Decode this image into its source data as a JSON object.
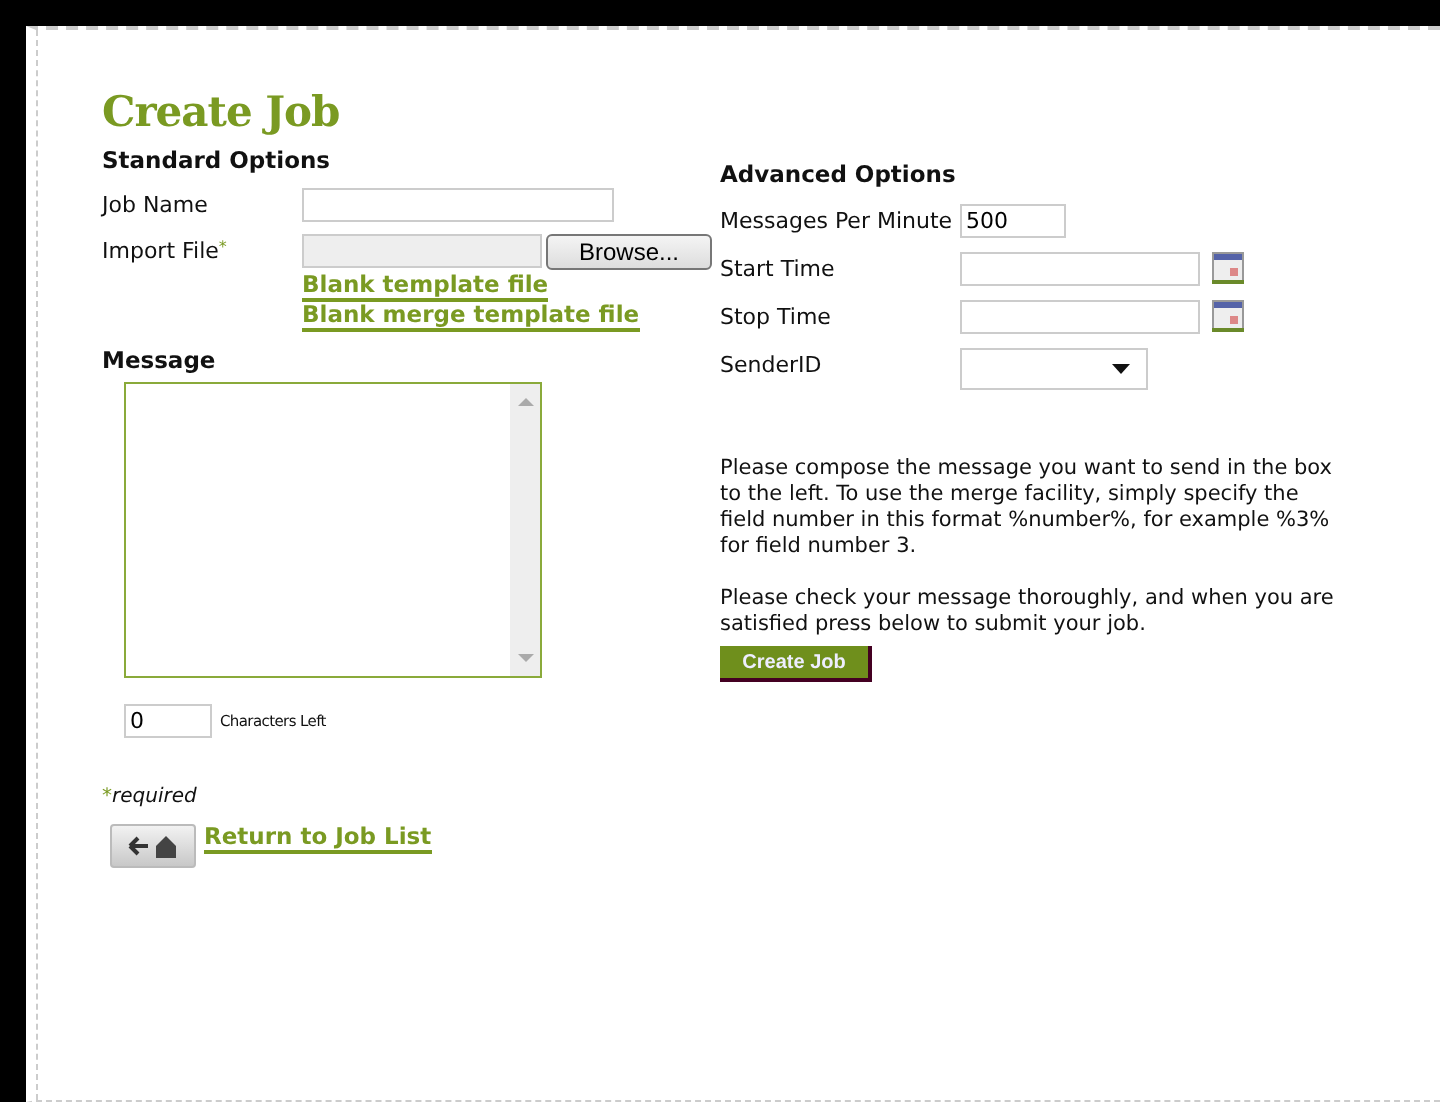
{
  "title": "Create Job",
  "standard_options": {
    "heading": "Standard Options",
    "job_name": {
      "label": "Job Name"
    },
    "import_file": {
      "label": "Import File",
      "required_mark": "*",
      "button": "Browse..."
    },
    "links": [
      "Blank template file",
      "Blank merge template file"
    ]
  },
  "message": {
    "heading": "Message",
    "counter": "0",
    "counter_label": "Characters Left"
  },
  "required_note": {
    "mark": "*",
    "text": "required"
  },
  "return_link": "Return to Job List",
  "advanced_options": {
    "heading": "Advanced Options",
    "fields": [
      {
        "kind": "text",
        "label": "Messages Per Minute",
        "value": "500"
      },
      {
        "kind": "date",
        "label": "Start Time"
      },
      {
        "kind": "date",
        "label": "Stop Time"
      },
      {
        "kind": "select",
        "label": "SenderID"
      }
    ]
  },
  "instructions": [
    "Please compose the message you want to send in the box to the left. To use the merge facility, simply specify the field number in this format %number%, for example %3% for field number 3.",
    "Please check your message thoroughly, and when you are satisfied press below to submit your job."
  ],
  "submit_button": "Create Job"
}
